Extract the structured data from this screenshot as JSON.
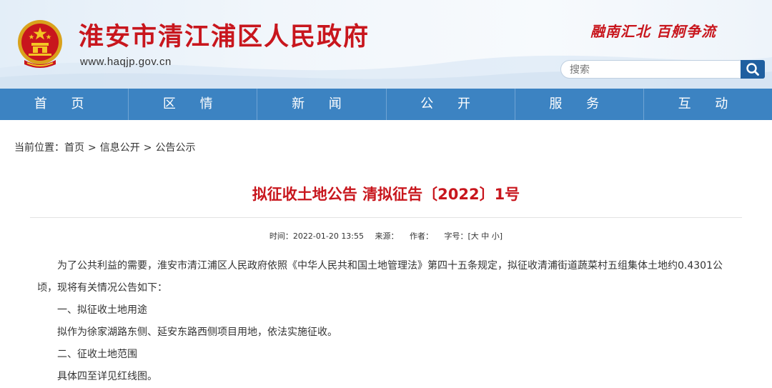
{
  "header": {
    "site_title": "淮安市清江浦区人民政府",
    "site_url": "www.haqjp.gov.cn",
    "slogan": "融南汇北 百舸争流",
    "search_placeholder": "搜索"
  },
  "nav": {
    "items": [
      "首 页",
      "区 情",
      "新 闻",
      "公 开",
      "服 务",
      "互 动"
    ]
  },
  "breadcrumb": {
    "prefix": "当前位置：",
    "items": [
      "首页",
      "信息公开",
      "公告公示"
    ],
    "separator": ">"
  },
  "article": {
    "title": "拟征收土地公告 清拟征告〔2022〕1号",
    "meta": {
      "time_label": "时间：2022-01-20 13:55",
      "source_label": "来源：",
      "author_label": "作者：",
      "size_label": "字号：",
      "size_options": "[大 中 小]"
    },
    "paragraphs": [
      "为了公共利益的需要，淮安市清江浦区人民政府依照《中华人民共和国土地管理法》第四十五条规定，拟征收清浦街道蔬菜村五组集体土地约0.4301公顷，现将有关情况公告如下：",
      "一、拟征收土地用途",
      "拟作为徐家湖路东侧、延安东路西侧项目用地，依法实施征收。",
      "二、征收土地范围",
      "具体四至详见红线图。"
    ]
  },
  "colors": {
    "brand_red": "#c8161d",
    "nav_blue": "#3c83c2",
    "search_blue": "#1f5fa0"
  },
  "icons": {
    "emblem": "national-emblem-icon",
    "search": "search-icon"
  }
}
